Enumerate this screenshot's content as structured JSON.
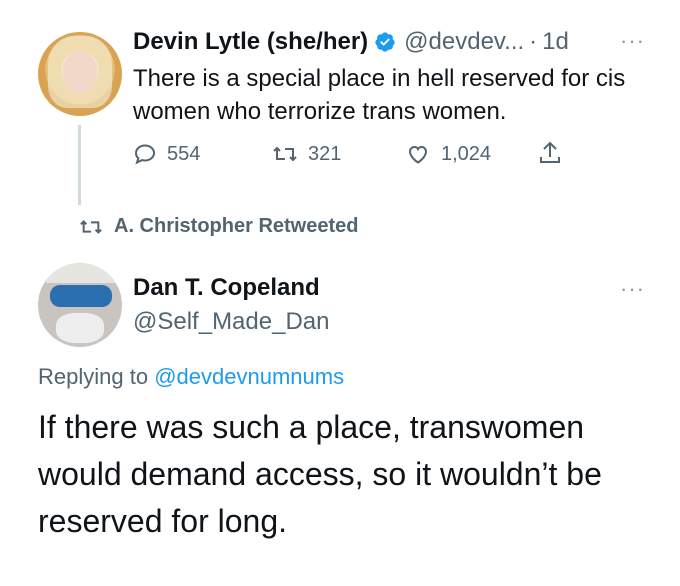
{
  "tweet1": {
    "author_name": "Devin Lytle (she/her)",
    "handle": "@devdev...",
    "dot": "·",
    "time": "1d",
    "text": "There is a special place in hell reserved for cis women who terrorize trans women.",
    "more": "···",
    "replies": "554",
    "retweets": "321",
    "likes": "1,024"
  },
  "retweet_banner": {
    "text": "A. Christopher Retweeted"
  },
  "tweet2": {
    "author_name": "Dan T. Copeland",
    "handle": "@Self_Made_Dan",
    "more": "···",
    "replying_prefix": "Replying to",
    "replying_to": "@devdevnumnums",
    "text": "If there was such a place, transwomen would demand access, so it wouldn’t be reserved for long."
  },
  "colors": {
    "accent": "#1d9bf0",
    "muted": "#536471",
    "text": "#0f1419"
  }
}
